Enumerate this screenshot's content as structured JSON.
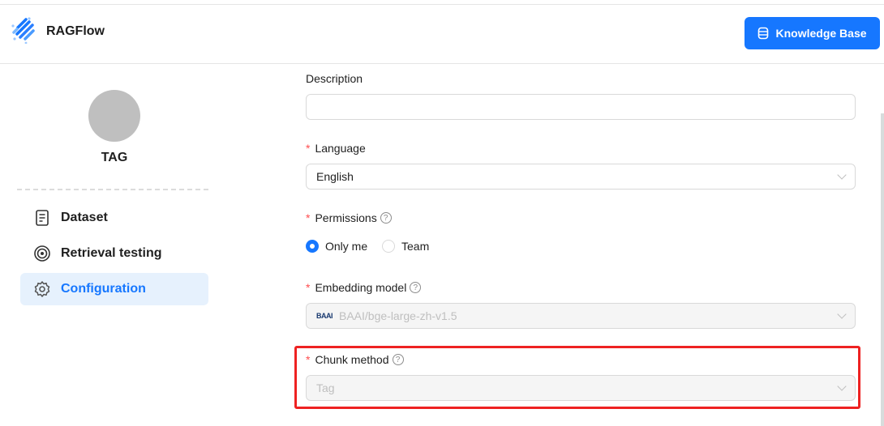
{
  "header": {
    "brand": "RAGFlow",
    "knowledge_base_button": "Knowledge Base"
  },
  "sidebar": {
    "kb_name": "TAG",
    "items": [
      {
        "label": "Dataset"
      },
      {
        "label": "Retrieval testing"
      },
      {
        "label": "Configuration",
        "active": true
      }
    ]
  },
  "form": {
    "description": {
      "label": "Description",
      "value": ""
    },
    "language": {
      "label": "Language",
      "value": "English"
    },
    "permissions": {
      "label": "Permissions",
      "options": [
        "Only me",
        "Team"
      ],
      "selected": "Only me"
    },
    "embedding_model": {
      "label": "Embedding model",
      "value": "BAAI/bge-large-zh-v1.5",
      "logo_text": "BAAI"
    },
    "chunk_method": {
      "label": "Chunk method",
      "value": "Tag"
    }
  },
  "colors": {
    "accent": "#1677ff",
    "highlight": "#ee2222"
  }
}
